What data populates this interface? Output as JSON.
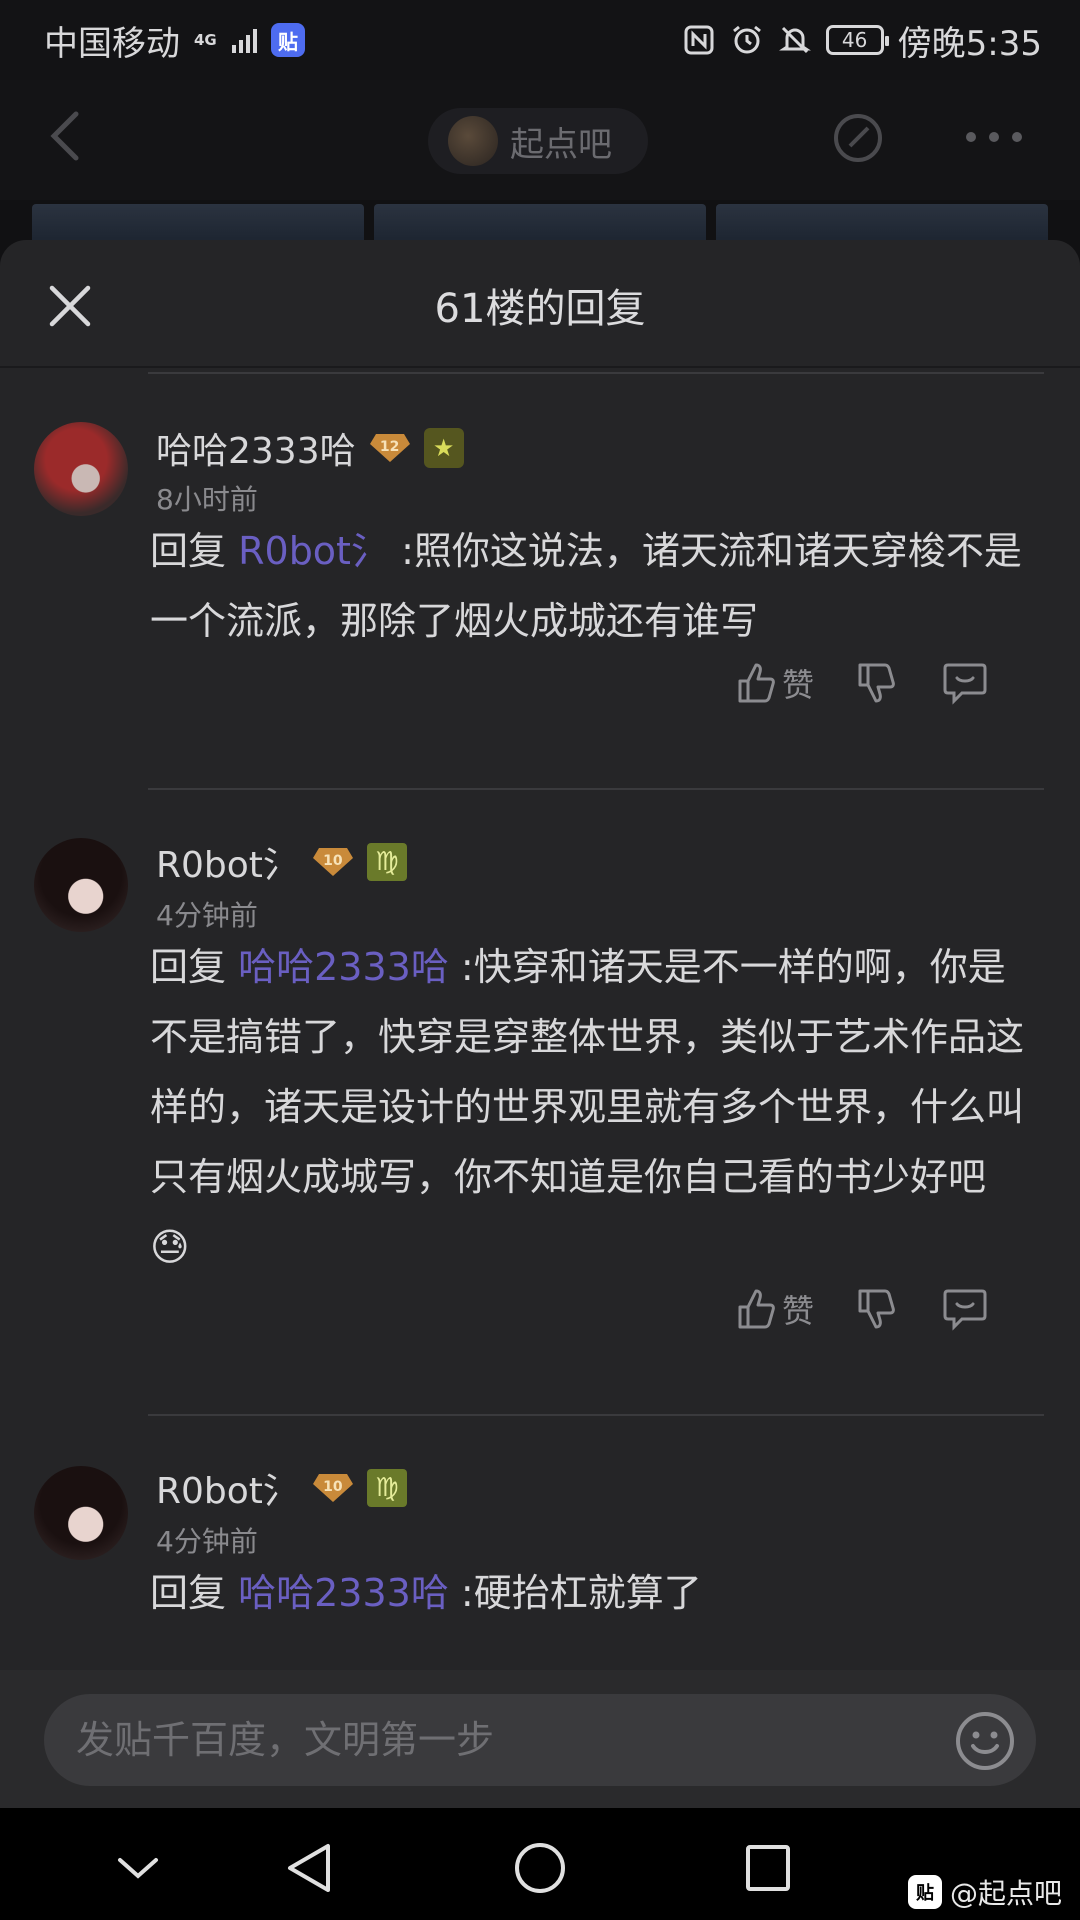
{
  "status_bar": {
    "carrier": "中国移动",
    "network_type": "4G",
    "app_badge": "贴",
    "battery": "46",
    "time": "傍晚5:35"
  },
  "top_nav": {
    "forum_name": "起点吧"
  },
  "sheet": {
    "title": "61楼的回复"
  },
  "replies": [
    {
      "username": "哈哈2333哈",
      "level": "12",
      "time": "8小时前",
      "prefix": "回复",
      "mention": "R0bot氵",
      "text": ":照你这说法，诸天流和诸天穿梭不是一个流派，那除了烟火成城还有谁写",
      "like_label": "赞"
    },
    {
      "username": "R0bot氵",
      "level": "10",
      "time": "4分钟前",
      "prefix": "回复",
      "mention": "哈哈2333哈",
      "text": ":快穿和诸天是不一样的啊，你是不是搞错了，快穿是穿整体世界，类似于艺术作品这样的，诸天是设计的世界观里就有多个世界，什么叫只有烟火成城写，你不知道是你自己看的书少好吧",
      "like_label": "赞"
    },
    {
      "username": "R0bot氵",
      "level": "10",
      "time": "4分钟前",
      "prefix": "回复",
      "mention": "哈哈2333哈",
      "text": ":硬抬杠就算了"
    }
  ],
  "input": {
    "placeholder": "发贴千百度，文明第一步"
  },
  "watermark": {
    "badge": "贴",
    "text": "@起点吧"
  },
  "colors": {
    "sheet_bg": "#252527",
    "mention": "#6a5fc2",
    "level_badge": "#c98a3a"
  }
}
